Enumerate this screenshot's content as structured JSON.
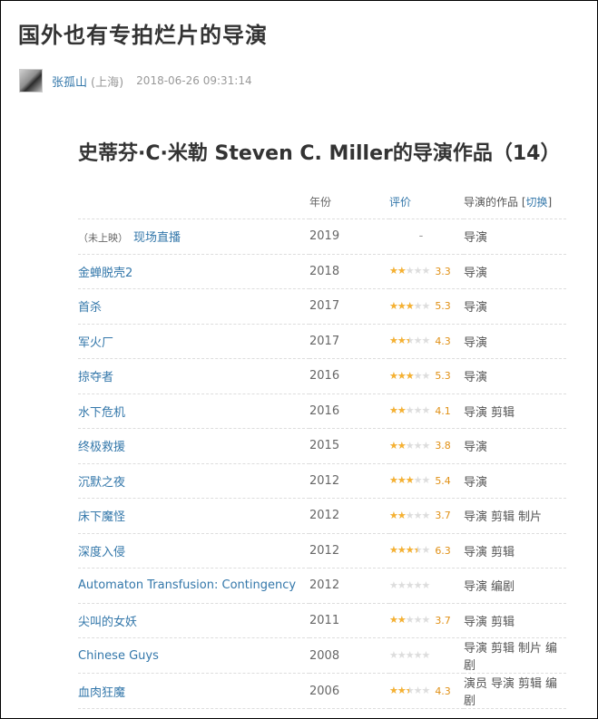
{
  "article": {
    "title": "国外也有专拍烂片的导演",
    "author": "张孤山",
    "location": "(上海)",
    "timestamp": "2018-06-26 09:31:14"
  },
  "filmography": {
    "heading": "史蒂芬·C·米勒 Steven C. Miller的导演作品（14）",
    "columns": {
      "year": "年份",
      "rating": "评价",
      "roles_prefix": "导演的作品 [",
      "switch": "切换",
      "roles_suffix": "]"
    },
    "rows": [
      {
        "tag": "（未上映）",
        "title": "现场直播",
        "year": "2019",
        "rating_text": "-",
        "stars": null,
        "score": "",
        "roles": [
          "导演"
        ]
      },
      {
        "tag": "",
        "title": "金蝉脱壳2",
        "year": "2018",
        "rating_text": "",
        "stars": 2,
        "score": "3.3",
        "roles": [
          "导演"
        ]
      },
      {
        "tag": "",
        "title": "首杀",
        "year": "2017",
        "rating_text": "",
        "stars": 3,
        "score": "5.3",
        "roles": [
          "导演"
        ]
      },
      {
        "tag": "",
        "title": "军火厂",
        "year": "2017",
        "rating_text": "",
        "stars": 2.5,
        "score": "4.3",
        "roles": [
          "导演"
        ]
      },
      {
        "tag": "",
        "title": "掠夺者",
        "year": "2016",
        "rating_text": "",
        "stars": 3,
        "score": "5.3",
        "roles": [
          "导演"
        ]
      },
      {
        "tag": "",
        "title": "水下危机",
        "year": "2016",
        "rating_text": "",
        "stars": 2,
        "score": "4.1",
        "roles": [
          "导演",
          "剪辑"
        ]
      },
      {
        "tag": "",
        "title": "终极救援",
        "year": "2015",
        "rating_text": "",
        "stars": 2,
        "score": "3.8",
        "roles": [
          "导演"
        ]
      },
      {
        "tag": "",
        "title": "沉默之夜",
        "year": "2012",
        "rating_text": "",
        "stars": 3,
        "score": "5.4",
        "roles": [
          "导演"
        ]
      },
      {
        "tag": "",
        "title": "床下魔怪",
        "year": "2012",
        "rating_text": "",
        "stars": 2,
        "score": "3.7",
        "roles": [
          "导演",
          "剪辑",
          "制片"
        ]
      },
      {
        "tag": "",
        "title": "深度入侵",
        "year": "2012",
        "rating_text": "",
        "stars": 3.5,
        "score": "6.3",
        "roles": [
          "导演",
          "剪辑"
        ]
      },
      {
        "tag": "",
        "title": "Automaton Transfusion: Contingency",
        "year": "2012",
        "rating_text": "",
        "stars": 0,
        "score": "",
        "roles": [
          "导演",
          "编剧"
        ]
      },
      {
        "tag": "",
        "title": "尖叫的女妖",
        "year": "2011",
        "rating_text": "",
        "stars": 2,
        "score": "3.7",
        "roles": [
          "导演",
          "剪辑"
        ]
      },
      {
        "tag": "",
        "title": "Chinese Guys",
        "year": "2008",
        "rating_text": "",
        "stars": 0,
        "score": "",
        "roles": [
          "导演",
          "剪辑",
          "制片",
          "编剧"
        ]
      },
      {
        "tag": "",
        "title": "血肉狂魔",
        "year": "2006",
        "rating_text": "",
        "stars": 2.5,
        "score": "4.3",
        "roles": [
          "演员",
          "导演",
          "剪辑",
          "编剧"
        ]
      }
    ]
  },
  "colors": {
    "link": "#3377aa",
    "star": "#f6b131",
    "score": "#e09015"
  }
}
